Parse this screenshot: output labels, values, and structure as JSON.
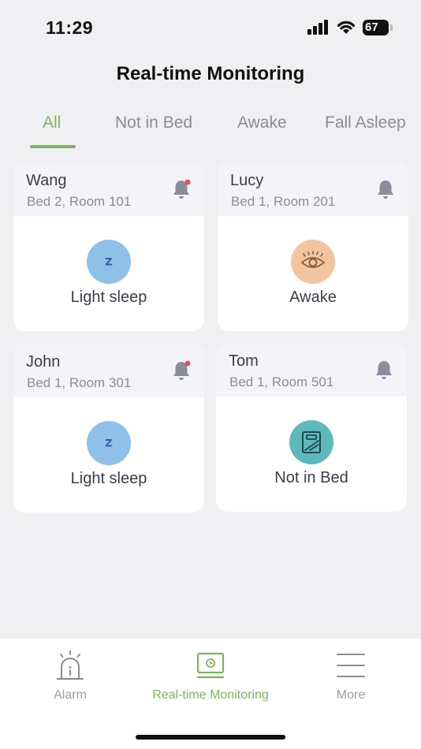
{
  "status_bar": {
    "time": "11:29",
    "battery": "67"
  },
  "header": {
    "title": "Real-time Monitoring"
  },
  "tabs": [
    {
      "label": "All",
      "active": true
    },
    {
      "label": "Not in Bed",
      "active": false
    },
    {
      "label": "Awake",
      "active": false
    },
    {
      "label": "Fall Asleep",
      "active": false
    }
  ],
  "residents": [
    {
      "name": "Wang",
      "location": "Bed 2, Room 101",
      "status": "Light sleep",
      "status_icon": "sleep-z-icon",
      "alert": true,
      "status_color": "#8fc1e8"
    },
    {
      "name": "Lucy",
      "location": "Bed 1, Room 201",
      "status": "Awake",
      "status_icon": "eye-icon",
      "alert": false,
      "status_color": "#f2c4a0"
    },
    {
      "name": "John",
      "location": "Bed 1, Room 301",
      "status": "Light sleep",
      "status_icon": "sleep-z-icon",
      "alert": true,
      "status_color": "#8fc1e8"
    },
    {
      "name": "Tom",
      "location": "Bed 1, Room 501",
      "status": "Not in Bed",
      "status_icon": "empty-bed-icon",
      "alert": false,
      "status_color": "#5fb8bb"
    }
  ],
  "bottom_nav": [
    {
      "label": "Alarm",
      "icon": "alarm-icon",
      "active": false
    },
    {
      "label": "Real-time Monitoring",
      "icon": "monitor-icon",
      "active": true
    },
    {
      "label": "More",
      "icon": "menu-icon",
      "active": false
    }
  ],
  "colors": {
    "accent": "#7ab55c",
    "alert_dot": "#e8505b",
    "background": "#f0f0f2"
  }
}
